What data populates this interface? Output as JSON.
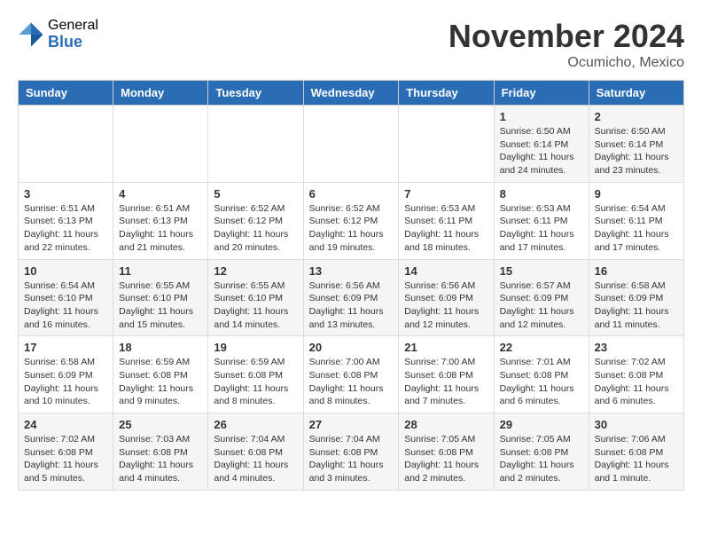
{
  "logo": {
    "general": "General",
    "blue": "Blue"
  },
  "title": "November 2024",
  "location": "Ocumicho, Mexico",
  "days_of_week": [
    "Sunday",
    "Monday",
    "Tuesday",
    "Wednesday",
    "Thursday",
    "Friday",
    "Saturday"
  ],
  "weeks": [
    [
      {
        "day": "",
        "info": ""
      },
      {
        "day": "",
        "info": ""
      },
      {
        "day": "",
        "info": ""
      },
      {
        "day": "",
        "info": ""
      },
      {
        "day": "",
        "info": ""
      },
      {
        "day": "1",
        "info": "Sunrise: 6:50 AM\nSunset: 6:14 PM\nDaylight: 11 hours and 24 minutes."
      },
      {
        "day": "2",
        "info": "Sunrise: 6:50 AM\nSunset: 6:14 PM\nDaylight: 11 hours and 23 minutes."
      }
    ],
    [
      {
        "day": "3",
        "info": "Sunrise: 6:51 AM\nSunset: 6:13 PM\nDaylight: 11 hours and 22 minutes."
      },
      {
        "day": "4",
        "info": "Sunrise: 6:51 AM\nSunset: 6:13 PM\nDaylight: 11 hours and 21 minutes."
      },
      {
        "day": "5",
        "info": "Sunrise: 6:52 AM\nSunset: 6:12 PM\nDaylight: 11 hours and 20 minutes."
      },
      {
        "day": "6",
        "info": "Sunrise: 6:52 AM\nSunset: 6:12 PM\nDaylight: 11 hours and 19 minutes."
      },
      {
        "day": "7",
        "info": "Sunrise: 6:53 AM\nSunset: 6:11 PM\nDaylight: 11 hours and 18 minutes."
      },
      {
        "day": "8",
        "info": "Sunrise: 6:53 AM\nSunset: 6:11 PM\nDaylight: 11 hours and 17 minutes."
      },
      {
        "day": "9",
        "info": "Sunrise: 6:54 AM\nSunset: 6:11 PM\nDaylight: 11 hours and 17 minutes."
      }
    ],
    [
      {
        "day": "10",
        "info": "Sunrise: 6:54 AM\nSunset: 6:10 PM\nDaylight: 11 hours and 16 minutes."
      },
      {
        "day": "11",
        "info": "Sunrise: 6:55 AM\nSunset: 6:10 PM\nDaylight: 11 hours and 15 minutes."
      },
      {
        "day": "12",
        "info": "Sunrise: 6:55 AM\nSunset: 6:10 PM\nDaylight: 11 hours and 14 minutes."
      },
      {
        "day": "13",
        "info": "Sunrise: 6:56 AM\nSunset: 6:09 PM\nDaylight: 11 hours and 13 minutes."
      },
      {
        "day": "14",
        "info": "Sunrise: 6:56 AM\nSunset: 6:09 PM\nDaylight: 11 hours and 12 minutes."
      },
      {
        "day": "15",
        "info": "Sunrise: 6:57 AM\nSunset: 6:09 PM\nDaylight: 11 hours and 12 minutes."
      },
      {
        "day": "16",
        "info": "Sunrise: 6:58 AM\nSunset: 6:09 PM\nDaylight: 11 hours and 11 minutes."
      }
    ],
    [
      {
        "day": "17",
        "info": "Sunrise: 6:58 AM\nSunset: 6:09 PM\nDaylight: 11 hours and 10 minutes."
      },
      {
        "day": "18",
        "info": "Sunrise: 6:59 AM\nSunset: 6:08 PM\nDaylight: 11 hours and 9 minutes."
      },
      {
        "day": "19",
        "info": "Sunrise: 6:59 AM\nSunset: 6:08 PM\nDaylight: 11 hours and 8 minutes."
      },
      {
        "day": "20",
        "info": "Sunrise: 7:00 AM\nSunset: 6:08 PM\nDaylight: 11 hours and 8 minutes."
      },
      {
        "day": "21",
        "info": "Sunrise: 7:00 AM\nSunset: 6:08 PM\nDaylight: 11 hours and 7 minutes."
      },
      {
        "day": "22",
        "info": "Sunrise: 7:01 AM\nSunset: 6:08 PM\nDaylight: 11 hours and 6 minutes."
      },
      {
        "day": "23",
        "info": "Sunrise: 7:02 AM\nSunset: 6:08 PM\nDaylight: 11 hours and 6 minutes."
      }
    ],
    [
      {
        "day": "24",
        "info": "Sunrise: 7:02 AM\nSunset: 6:08 PM\nDaylight: 11 hours and 5 minutes."
      },
      {
        "day": "25",
        "info": "Sunrise: 7:03 AM\nSunset: 6:08 PM\nDaylight: 11 hours and 4 minutes."
      },
      {
        "day": "26",
        "info": "Sunrise: 7:04 AM\nSunset: 6:08 PM\nDaylight: 11 hours and 4 minutes."
      },
      {
        "day": "27",
        "info": "Sunrise: 7:04 AM\nSunset: 6:08 PM\nDaylight: 11 hours and 3 minutes."
      },
      {
        "day": "28",
        "info": "Sunrise: 7:05 AM\nSunset: 6:08 PM\nDaylight: 11 hours and 2 minutes."
      },
      {
        "day": "29",
        "info": "Sunrise: 7:05 AM\nSunset: 6:08 PM\nDaylight: 11 hours and 2 minutes."
      },
      {
        "day": "30",
        "info": "Sunrise: 7:06 AM\nSunset: 6:08 PM\nDaylight: 11 hours and 1 minute."
      }
    ]
  ]
}
